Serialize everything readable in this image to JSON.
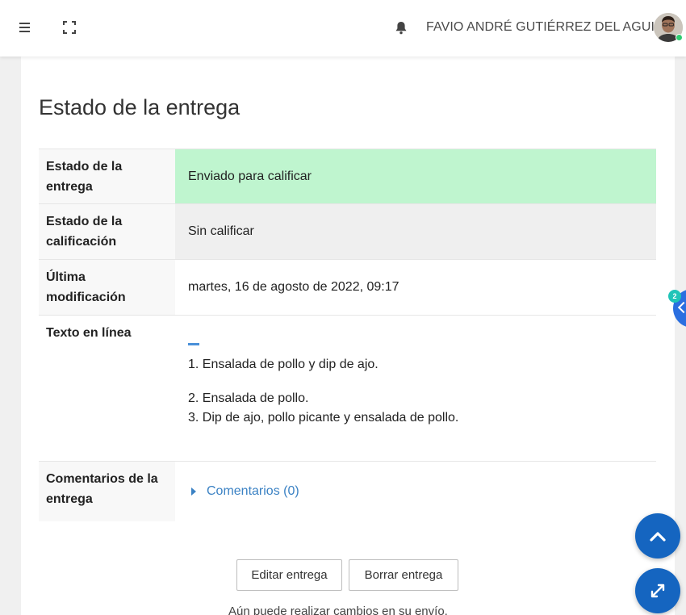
{
  "header": {
    "user_name": "FAVIO ANDRÉ GUTIÉRREZ DEL AGUILA",
    "menu_icon": "hamburger-menu-icon",
    "fullscreen_icon": "fullscreen-icon",
    "notifications_icon": "bell-icon"
  },
  "page": {
    "title": "Estado de la entrega"
  },
  "submission_table": {
    "rows": [
      {
        "label": "Estado de la entrega",
        "value": "Enviado para calificar",
        "color": "#bff5cf"
      },
      {
        "label": "Estado de la calificación",
        "value": "Sin calificar",
        "color": "#efefef"
      },
      {
        "label": "Última modificación",
        "value": "martes, 16 de agosto de 2022, 09:17"
      },
      {
        "label": "Texto en línea",
        "items": [
          "1. Ensalada de pollo y dip de ajo.",
          "2. Ensalada de pollo.",
          "3. Dip de ajo, pollo picante y ensalada de pollo."
        ]
      },
      {
        "label": "Comentarios de la entrega",
        "link": "Comentarios (0)"
      }
    ]
  },
  "actions": {
    "edit_label": "Editar entrega",
    "delete_label": "Borrar entrega",
    "note": "Aún puede realizar cambios en su envío."
  },
  "side_panel": {
    "badge_count": "2"
  },
  "colors": {
    "accent": "#1565c0",
    "link": "#3b82c4",
    "submitted_bg": "#bff5cf"
  }
}
